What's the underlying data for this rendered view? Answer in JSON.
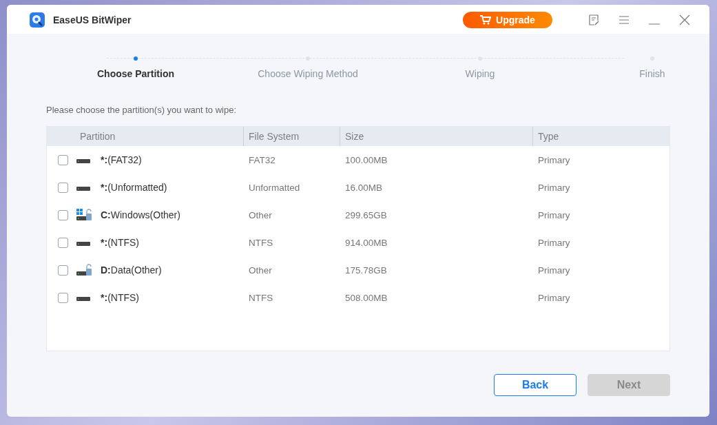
{
  "window": {
    "title": "EaseUS BitWiper",
    "upgrade": "Upgrade"
  },
  "steps": [
    {
      "label": "Choose Partition",
      "selected": true
    },
    {
      "label": "Choose Wiping Method",
      "selected": false
    },
    {
      "label": "Wiping",
      "selected": false
    },
    {
      "label": "Finish",
      "selected": false
    }
  ],
  "prompt": "Please choose the partition(s) you want to wipe:",
  "table": {
    "columns": [
      "Partition",
      "File System",
      "Size",
      "Type"
    ],
    "rows": [
      {
        "kind": "plain",
        "checked": false,
        "letter": "*:",
        "label": "(FAT32)",
        "fs": "FAT32",
        "size": "100.00MB",
        "type": "Primary"
      },
      {
        "kind": "plain",
        "checked": false,
        "letter": "*:",
        "label": "(Unformatted)",
        "fs": "Unformatted",
        "size": "16.00MB",
        "type": "Primary"
      },
      {
        "kind": "system",
        "checked": false,
        "letter": "C:",
        "label": "Windows(Other)",
        "fs": "Other",
        "size": "299.65GB",
        "type": "Primary"
      },
      {
        "kind": "plain",
        "checked": false,
        "letter": "*:",
        "label": "(NTFS)",
        "fs": "NTFS",
        "size": "914.00MB",
        "type": "Primary"
      },
      {
        "kind": "locked",
        "checked": false,
        "letter": "D:",
        "label": "Data(Other)",
        "fs": "Other",
        "size": "175.78GB",
        "type": "Primary"
      },
      {
        "kind": "plain",
        "checked": false,
        "letter": "*:",
        "label": "(NTFS)",
        "fs": "NTFS",
        "size": "508.00MB",
        "type": "Primary"
      }
    ]
  },
  "buttons": [
    {
      "label": "Back",
      "disabled": false
    },
    {
      "label": "Next",
      "disabled": true
    }
  ]
}
